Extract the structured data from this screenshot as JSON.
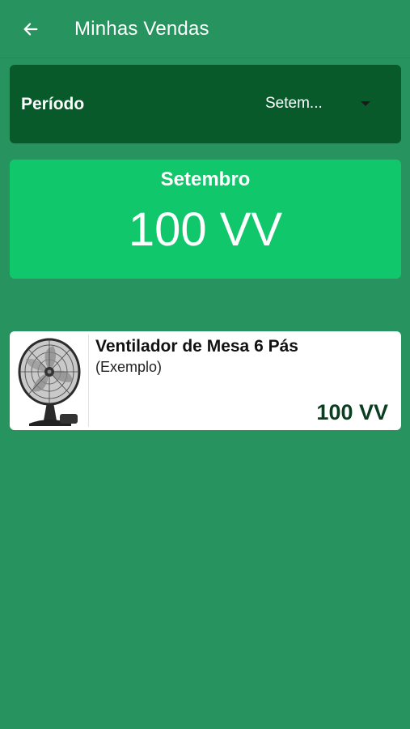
{
  "header": {
    "title": "Minhas Vendas",
    "back_icon": "arrow-left-icon"
  },
  "period": {
    "label": "Período",
    "selected": "Setem...",
    "dropdown_icon": "chevron-down-icon"
  },
  "summary": {
    "month": "Setembro",
    "total": "100 VV"
  },
  "products": [
    {
      "name": "Ventilador de Mesa 6 Pás",
      "subtitle": "(Exemplo)",
      "price": "100 VV",
      "image_icon": "table-fan-image"
    }
  ],
  "colors": {
    "background": "#27935F",
    "period_bar": "#085A2A",
    "summary_card": "#11C76B",
    "price_text": "#0B3D20"
  }
}
